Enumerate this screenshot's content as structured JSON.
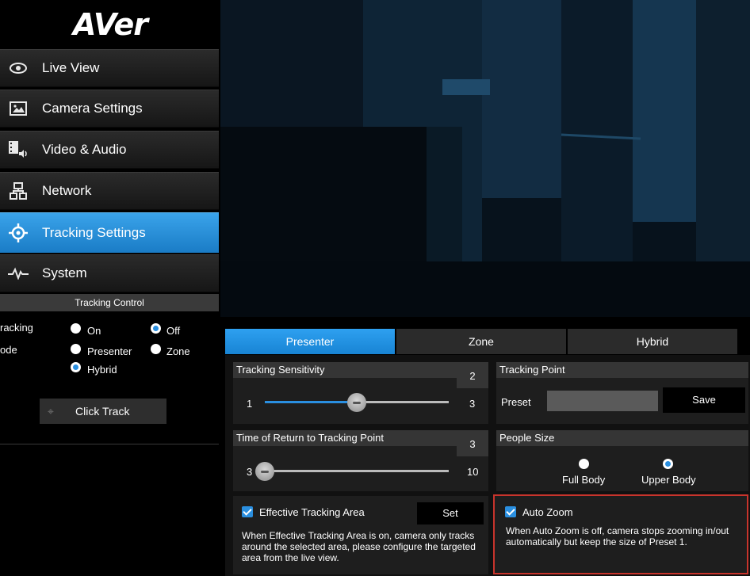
{
  "brand": {
    "logo_text": "AVer"
  },
  "sidebar": {
    "items": [
      {
        "label": "Live View",
        "icon": "eye-icon"
      },
      {
        "label": "Camera Settings",
        "icon": "image-icon"
      },
      {
        "label": "Video & Audio",
        "icon": "video-audio-icon"
      },
      {
        "label": "Network",
        "icon": "network-icon"
      },
      {
        "label": "Tracking Settings",
        "icon": "crosshair-icon",
        "active": true
      },
      {
        "label": "System",
        "icon": "pulse-icon"
      }
    ],
    "tracking_control": {
      "header": "Tracking Control",
      "tracking_label": "racking",
      "mode_label": "ode",
      "on_label": "On",
      "off_label": "Off",
      "presenter_label": "Presenter",
      "zone_label": "Zone",
      "hybrid_label": "Hybrid",
      "tracking_selected": "Off",
      "mode_selected": "Hybrid",
      "click_track_label": "Click Track"
    }
  },
  "tabs": [
    {
      "label": "Presenter",
      "active": true
    },
    {
      "label": "Zone",
      "active": false
    },
    {
      "label": "Hybrid",
      "active": false
    }
  ],
  "tracking_sensitivity": {
    "title": "Tracking Sensitivity",
    "value": "2",
    "min": "1",
    "max": "3",
    "level": 0.5
  },
  "return_time": {
    "title": "Time of Return to Tracking Point",
    "value": "3",
    "min": "3",
    "max": "10",
    "level": 0
  },
  "tracking_point": {
    "title": "Tracking Point",
    "preset_label": "Preset",
    "preset_value": "",
    "save_label": "Save"
  },
  "people_size": {
    "title": "People Size",
    "full_body_label": "Full Body",
    "upper_body_label": "Upper Body",
    "selected": "Upper Body"
  },
  "effective_area": {
    "label": "Effective Tracking Area",
    "checked": true,
    "set_label": "Set",
    "description": "When Effective Tracking Area is on, camera only tracks around the selected area, please configure the targeted area from the live view."
  },
  "auto_zoom": {
    "label": "Auto Zoom",
    "checked": true,
    "description": "When Auto Zoom is off, camera stops zooming in/out automatically but keep the size of Preset 1."
  },
  "colors": {
    "accent": "#1e8ee0",
    "highlight_border": "#c8342c",
    "panel_bg": "#1e1e1e"
  }
}
